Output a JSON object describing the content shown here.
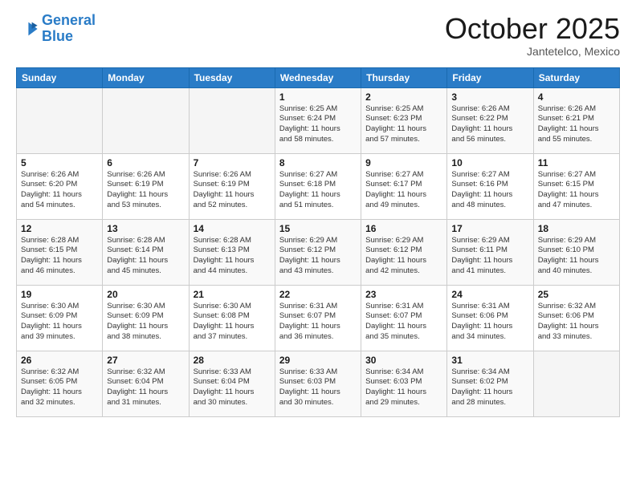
{
  "logo": {
    "line1": "General",
    "line2": "Blue"
  },
  "title": "October 2025",
  "subtitle": "Jantetelco, Mexico",
  "days_of_week": [
    "Sunday",
    "Monday",
    "Tuesday",
    "Wednesday",
    "Thursday",
    "Friday",
    "Saturday"
  ],
  "weeks": [
    [
      {
        "day": "",
        "info": ""
      },
      {
        "day": "",
        "info": ""
      },
      {
        "day": "",
        "info": ""
      },
      {
        "day": "1",
        "info": "Sunrise: 6:25 AM\nSunset: 6:24 PM\nDaylight: 11 hours\nand 58 minutes."
      },
      {
        "day": "2",
        "info": "Sunrise: 6:25 AM\nSunset: 6:23 PM\nDaylight: 11 hours\nand 57 minutes."
      },
      {
        "day": "3",
        "info": "Sunrise: 6:26 AM\nSunset: 6:22 PM\nDaylight: 11 hours\nand 56 minutes."
      },
      {
        "day": "4",
        "info": "Sunrise: 6:26 AM\nSunset: 6:21 PM\nDaylight: 11 hours\nand 55 minutes."
      }
    ],
    [
      {
        "day": "5",
        "info": "Sunrise: 6:26 AM\nSunset: 6:20 PM\nDaylight: 11 hours\nand 54 minutes."
      },
      {
        "day": "6",
        "info": "Sunrise: 6:26 AM\nSunset: 6:19 PM\nDaylight: 11 hours\nand 53 minutes."
      },
      {
        "day": "7",
        "info": "Sunrise: 6:26 AM\nSunset: 6:19 PM\nDaylight: 11 hours\nand 52 minutes."
      },
      {
        "day": "8",
        "info": "Sunrise: 6:27 AM\nSunset: 6:18 PM\nDaylight: 11 hours\nand 51 minutes."
      },
      {
        "day": "9",
        "info": "Sunrise: 6:27 AM\nSunset: 6:17 PM\nDaylight: 11 hours\nand 49 minutes."
      },
      {
        "day": "10",
        "info": "Sunrise: 6:27 AM\nSunset: 6:16 PM\nDaylight: 11 hours\nand 48 minutes."
      },
      {
        "day": "11",
        "info": "Sunrise: 6:27 AM\nSunset: 6:15 PM\nDaylight: 11 hours\nand 47 minutes."
      }
    ],
    [
      {
        "day": "12",
        "info": "Sunrise: 6:28 AM\nSunset: 6:15 PM\nDaylight: 11 hours\nand 46 minutes."
      },
      {
        "day": "13",
        "info": "Sunrise: 6:28 AM\nSunset: 6:14 PM\nDaylight: 11 hours\nand 45 minutes."
      },
      {
        "day": "14",
        "info": "Sunrise: 6:28 AM\nSunset: 6:13 PM\nDaylight: 11 hours\nand 44 minutes."
      },
      {
        "day": "15",
        "info": "Sunrise: 6:29 AM\nSunset: 6:12 PM\nDaylight: 11 hours\nand 43 minutes."
      },
      {
        "day": "16",
        "info": "Sunrise: 6:29 AM\nSunset: 6:12 PM\nDaylight: 11 hours\nand 42 minutes."
      },
      {
        "day": "17",
        "info": "Sunrise: 6:29 AM\nSunset: 6:11 PM\nDaylight: 11 hours\nand 41 minutes."
      },
      {
        "day": "18",
        "info": "Sunrise: 6:29 AM\nSunset: 6:10 PM\nDaylight: 11 hours\nand 40 minutes."
      }
    ],
    [
      {
        "day": "19",
        "info": "Sunrise: 6:30 AM\nSunset: 6:09 PM\nDaylight: 11 hours\nand 39 minutes."
      },
      {
        "day": "20",
        "info": "Sunrise: 6:30 AM\nSunset: 6:09 PM\nDaylight: 11 hours\nand 38 minutes."
      },
      {
        "day": "21",
        "info": "Sunrise: 6:30 AM\nSunset: 6:08 PM\nDaylight: 11 hours\nand 37 minutes."
      },
      {
        "day": "22",
        "info": "Sunrise: 6:31 AM\nSunset: 6:07 PM\nDaylight: 11 hours\nand 36 minutes."
      },
      {
        "day": "23",
        "info": "Sunrise: 6:31 AM\nSunset: 6:07 PM\nDaylight: 11 hours\nand 35 minutes."
      },
      {
        "day": "24",
        "info": "Sunrise: 6:31 AM\nSunset: 6:06 PM\nDaylight: 11 hours\nand 34 minutes."
      },
      {
        "day": "25",
        "info": "Sunrise: 6:32 AM\nSunset: 6:06 PM\nDaylight: 11 hours\nand 33 minutes."
      }
    ],
    [
      {
        "day": "26",
        "info": "Sunrise: 6:32 AM\nSunset: 6:05 PM\nDaylight: 11 hours\nand 32 minutes."
      },
      {
        "day": "27",
        "info": "Sunrise: 6:32 AM\nSunset: 6:04 PM\nDaylight: 11 hours\nand 31 minutes."
      },
      {
        "day": "28",
        "info": "Sunrise: 6:33 AM\nSunset: 6:04 PM\nDaylight: 11 hours\nand 30 minutes."
      },
      {
        "day": "29",
        "info": "Sunrise: 6:33 AM\nSunset: 6:03 PM\nDaylight: 11 hours\nand 30 minutes."
      },
      {
        "day": "30",
        "info": "Sunrise: 6:34 AM\nSunset: 6:03 PM\nDaylight: 11 hours\nand 29 minutes."
      },
      {
        "day": "31",
        "info": "Sunrise: 6:34 AM\nSunset: 6:02 PM\nDaylight: 11 hours\nand 28 minutes."
      },
      {
        "day": "",
        "info": ""
      }
    ]
  ]
}
